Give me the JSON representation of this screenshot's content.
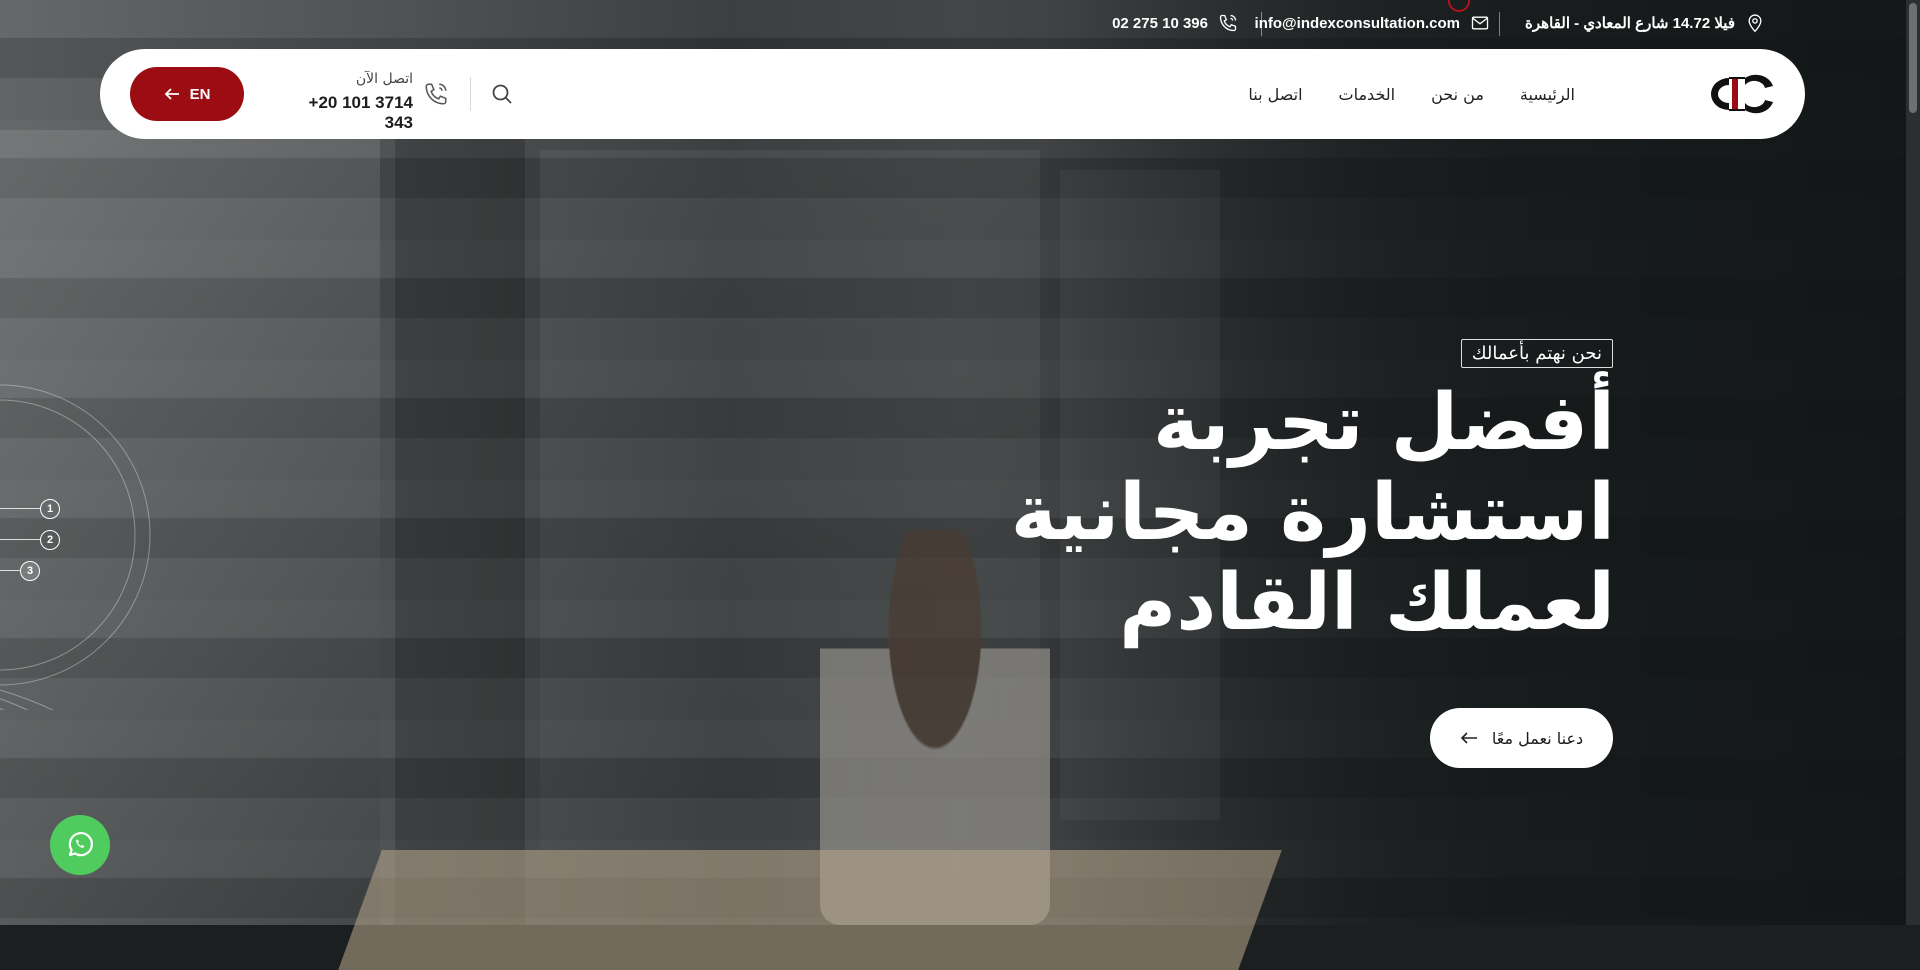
{
  "topbar": {
    "address": "فيلا 14.72 شارع المعادي - القاهرة",
    "email": "info@indexconsultation.com",
    "phone": "02 275 10 396"
  },
  "nav": {
    "items": [
      {
        "label": "الرئيسية"
      },
      {
        "label": "من نحن"
      },
      {
        "label": "الخدمات"
      },
      {
        "label": "اتصل بنا"
      }
    ],
    "call_label": "اتصل الآن",
    "call_number": "+20 101 3714 343",
    "lang_label": "EN"
  },
  "hero": {
    "tagline": "نحن نهتم بأعمالك",
    "headline_line1": "أفضل تجربة",
    "headline_line2": "استشارة مجانية",
    "headline_line3": "لعملك القادم",
    "cta_label": "دعنا نعمل معًا"
  },
  "slider": {
    "dots": [
      "1",
      "2",
      "3"
    ],
    "active": "3"
  },
  "colors": {
    "brand_red": "#9b0d12",
    "whatsapp_green": "#4fcc5d"
  },
  "icons": {
    "address": "location-pin-icon",
    "email": "mail-icon",
    "phone": "phone-icon",
    "search": "search-icon",
    "call": "phone-call-icon",
    "lang_arrow": "arrow-left-icon",
    "cta_arrow": "arrow-left-icon",
    "whatsapp": "whatsapp-icon"
  }
}
